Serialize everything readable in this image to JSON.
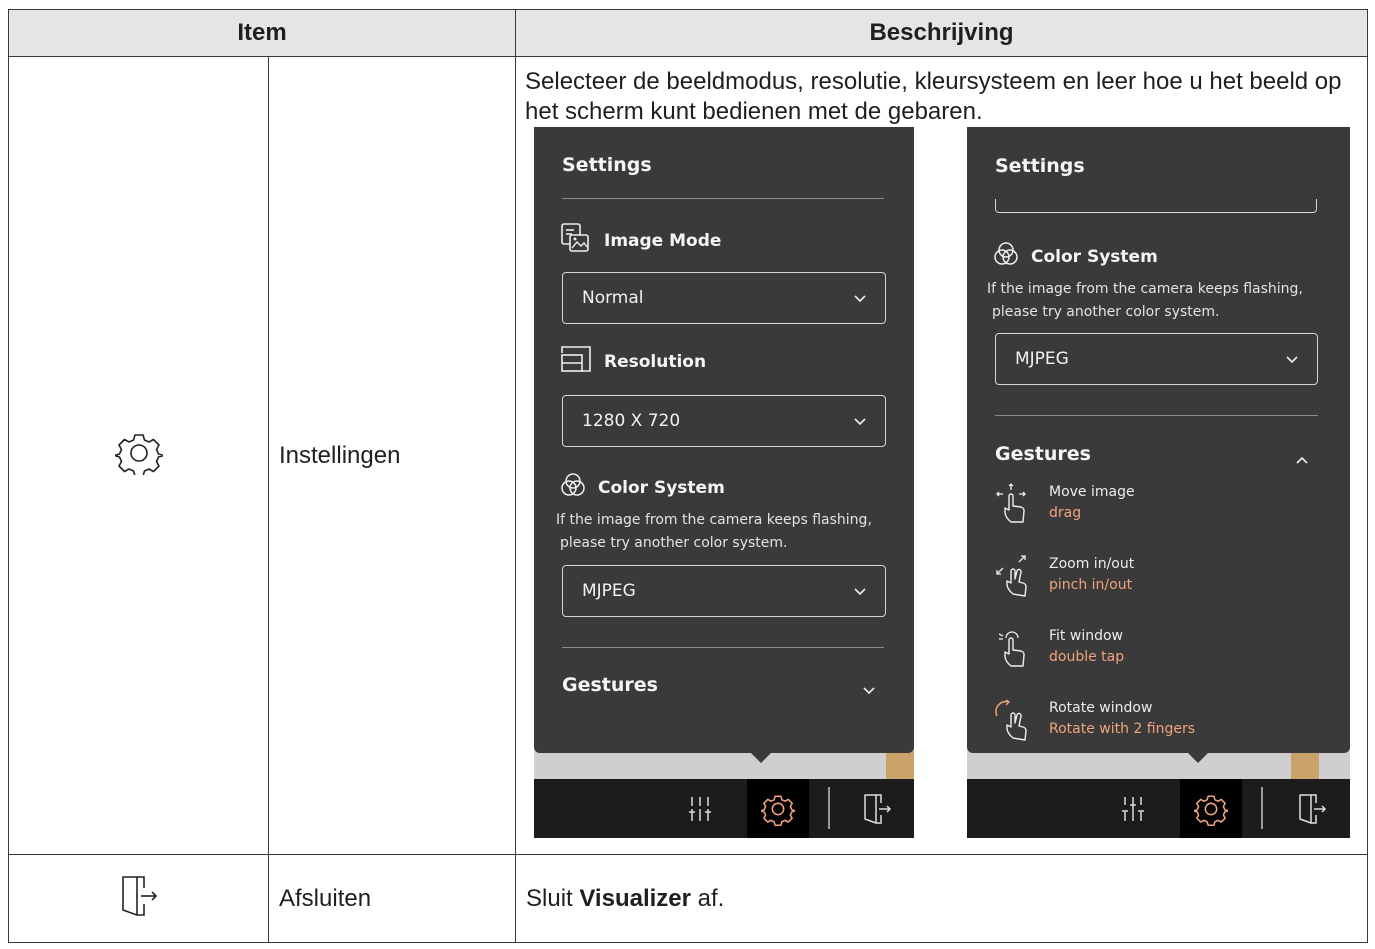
{
  "table": {
    "header_item": "Item",
    "header_desc": "Beschrijving",
    "rows": [
      {
        "icon": "gear-icon",
        "name": "Instellingen",
        "description": "Selecteer de beeldmodus, resolutie, kleursysteem en leer hoe u het beeld op het scherm kunt bedienen met de gebaren."
      },
      {
        "icon": "exit-door-icon",
        "name": "Afsluiten",
        "description_prefix": "Sluit ",
        "description_bold": "Visualizer",
        "description_suffix": " af."
      }
    ]
  },
  "screenshot_left": {
    "title": "Settings",
    "image_mode_label": "Image Mode",
    "image_mode_value": "Normal",
    "resolution_label": "Resolution",
    "resolution_value": "1280 X 720",
    "color_system_label": "Color System",
    "color_note_line1": "If the image from the camera keeps flashing,",
    "color_note_line2": "please try another color system.",
    "color_system_value": "MJPEG",
    "gestures_label": "Gestures"
  },
  "screenshot_right": {
    "title": "Settings",
    "color_system_label": "Color System",
    "color_note_line1": "If the image from the camera keeps flashing,",
    "color_note_line2": "please try another color system.",
    "color_system_value": "MJPEG",
    "gestures_label": "Gestures",
    "gestures": [
      {
        "action": "Move image",
        "gesture": "drag",
        "icon": "drag-hand-icon"
      },
      {
        "action": "Zoom in/out",
        "gesture": "pinch in/out",
        "icon": "pinch-hand-icon"
      },
      {
        "action": "Fit window",
        "gesture": "double tap",
        "icon": "tap-hand-icon"
      },
      {
        "action": "Rotate window",
        "gesture": "Rotate with 2 fingers",
        "icon": "rotate-hand-icon"
      }
    ]
  },
  "colors": {
    "panel_bg": "#3a3a3a",
    "toolbar_bg": "#1c1c1c",
    "accent_orange": "#f0a37e",
    "header_bg": "#e5e5e5"
  }
}
